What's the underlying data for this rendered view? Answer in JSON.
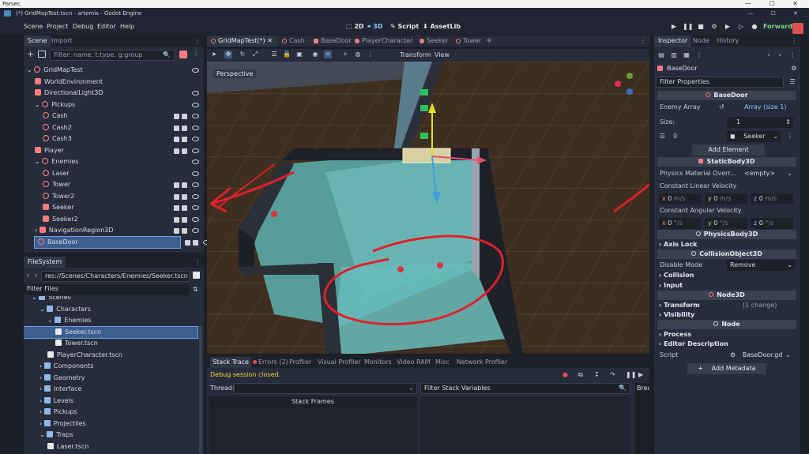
{
  "parsec": {
    "title": "Parsec",
    "controls": "— ☐ ✕"
  },
  "window": {
    "title": "(*) GridMapTest.tscn - artemis - Godot Engine",
    "controls": "— ☐ ✕"
  },
  "menu": [
    "Scene",
    "Project",
    "Debug",
    "Editor",
    "Help"
  ],
  "main_screens": [
    "2D",
    "3D",
    "Script",
    "AssetLib"
  ],
  "renderer": "Forward+",
  "scene_dock": {
    "tabs": [
      "Scene",
      "Import"
    ],
    "filter_placeholder": "Filter: name, t:type, g:group",
    "nodes": [
      {
        "label": "GridMapTest",
        "depth": 0
      },
      {
        "label": "WorldEnvironment",
        "depth": 1
      },
      {
        "label": "DirectionalLight3D",
        "depth": 1
      },
      {
        "label": "Pickups",
        "depth": 1
      },
      {
        "label": "Cash",
        "depth": 2
      },
      {
        "label": "Cash2",
        "depth": 2
      },
      {
        "label": "Cash3",
        "depth": 2
      },
      {
        "label": "Player",
        "depth": 1
      },
      {
        "label": "Enemies",
        "depth": 1
      },
      {
        "label": "Laser",
        "depth": 2
      },
      {
        "label": "Tower",
        "depth": 2
      },
      {
        "label": "Tower2",
        "depth": 2
      },
      {
        "label": "Seeker",
        "depth": 2
      },
      {
        "label": "Seeker2",
        "depth": 2
      },
      {
        "label": "NavigationRegion3D",
        "depth": 1
      },
      {
        "label": "BaseDoor",
        "depth": 1
      }
    ]
  },
  "filesystem_dock": {
    "title": "FileSystem",
    "path": "res://Scenes/Characters/Enemies/Seeker.tscn",
    "filter_placeholder": "Filter Files",
    "items": [
      {
        "label": "Scenes",
        "depth": 0
      },
      {
        "label": "Characters",
        "depth": 1
      },
      {
        "label": "Enemies",
        "depth": 2
      },
      {
        "label": "Seeker.tscn",
        "depth": 3
      },
      {
        "label": "Tower.tscn",
        "depth": 3
      },
      {
        "label": "PlayerCharacter.tscn",
        "depth": 2
      },
      {
        "label": "Components",
        "depth": 1
      },
      {
        "label": "Geometry",
        "depth": 1
      },
      {
        "label": "Interface",
        "depth": 1
      },
      {
        "label": "Levels",
        "depth": 1
      },
      {
        "label": "Pickups",
        "depth": 1
      },
      {
        "label": "Projectiles",
        "depth": 1
      },
      {
        "label": "Traps",
        "depth": 1
      },
      {
        "label": "Laser.tscn",
        "depth": 2
      }
    ]
  },
  "editor_tabs": [
    "GridMapTest(*)",
    "Cash",
    "BaseDoor",
    "PlayerCharacter",
    "Seeker",
    "Tower"
  ],
  "viewport_menu": {
    "transform": "Transform",
    "view": "View"
  },
  "viewport": {
    "perspective_label": "Perspective"
  },
  "bottom_panel": {
    "tabs": [
      "Stack Trace",
      "Errors (2)",
      "Profiler",
      "Visual Profiler",
      "Monitors",
      "Video RAM",
      "Misc",
      "Network Profiler"
    ],
    "status": "Debug session closed.",
    "thread_label": "Thread:",
    "filter_vars": "Filter Stack Variables",
    "stack_frames": "Stack Frames",
    "breakpoints": "Brea"
  },
  "inspector": {
    "tabs": [
      "Inspector",
      "Node",
      "History"
    ],
    "node_name": "BaseDoor",
    "filter_placeholder": "Filter Properties",
    "sections": {
      "basedoor": "BaseDoor",
      "enemy_array_label": "Enemy Array",
      "enemy_array_value": "Array (size 1)",
      "size_label": "Size:",
      "size_value": "1",
      "index_label": "0",
      "element_value": "Seeker",
      "add_element": "Add Element",
      "staticbody": "StaticBody3D",
      "physics_material_label": "Physics Material Overr...",
      "physics_material_value": "<empty>",
      "clv_label": "Constant Linear Velocity",
      "cav_label": "Constant Angular Velocity",
      "x": "x",
      "y": "y",
      "z": "z",
      "lin_val": "0",
      "lin_unit": "m/s",
      "ang_val": "0",
      "ang_unit": "°/s",
      "physicsbody": "PhysicsBody3D",
      "axis_lock": "Axis Lock",
      "collisionobject": "CollisionObject3D",
      "disable_mode_label": "Disable Mode",
      "disable_mode_value": "Remove",
      "collision": "Collision",
      "input": "Input",
      "node3d": "Node3D",
      "transform": "Transform",
      "transform_changes": "(1 change)",
      "visibility": "Visibility",
      "node": "Node",
      "process": "Process",
      "editor_description": "Editor Description",
      "script_label": "Script",
      "script_value": "BaseDoor.gd",
      "add_metadata": "Add Metadata"
    }
  },
  "colors": {
    "accent": "#5fb1ff",
    "node3d": "#fc7f7f",
    "annotation": "#e0202a",
    "floor": "#5bb0b0",
    "ground": "#3d2e20"
  }
}
